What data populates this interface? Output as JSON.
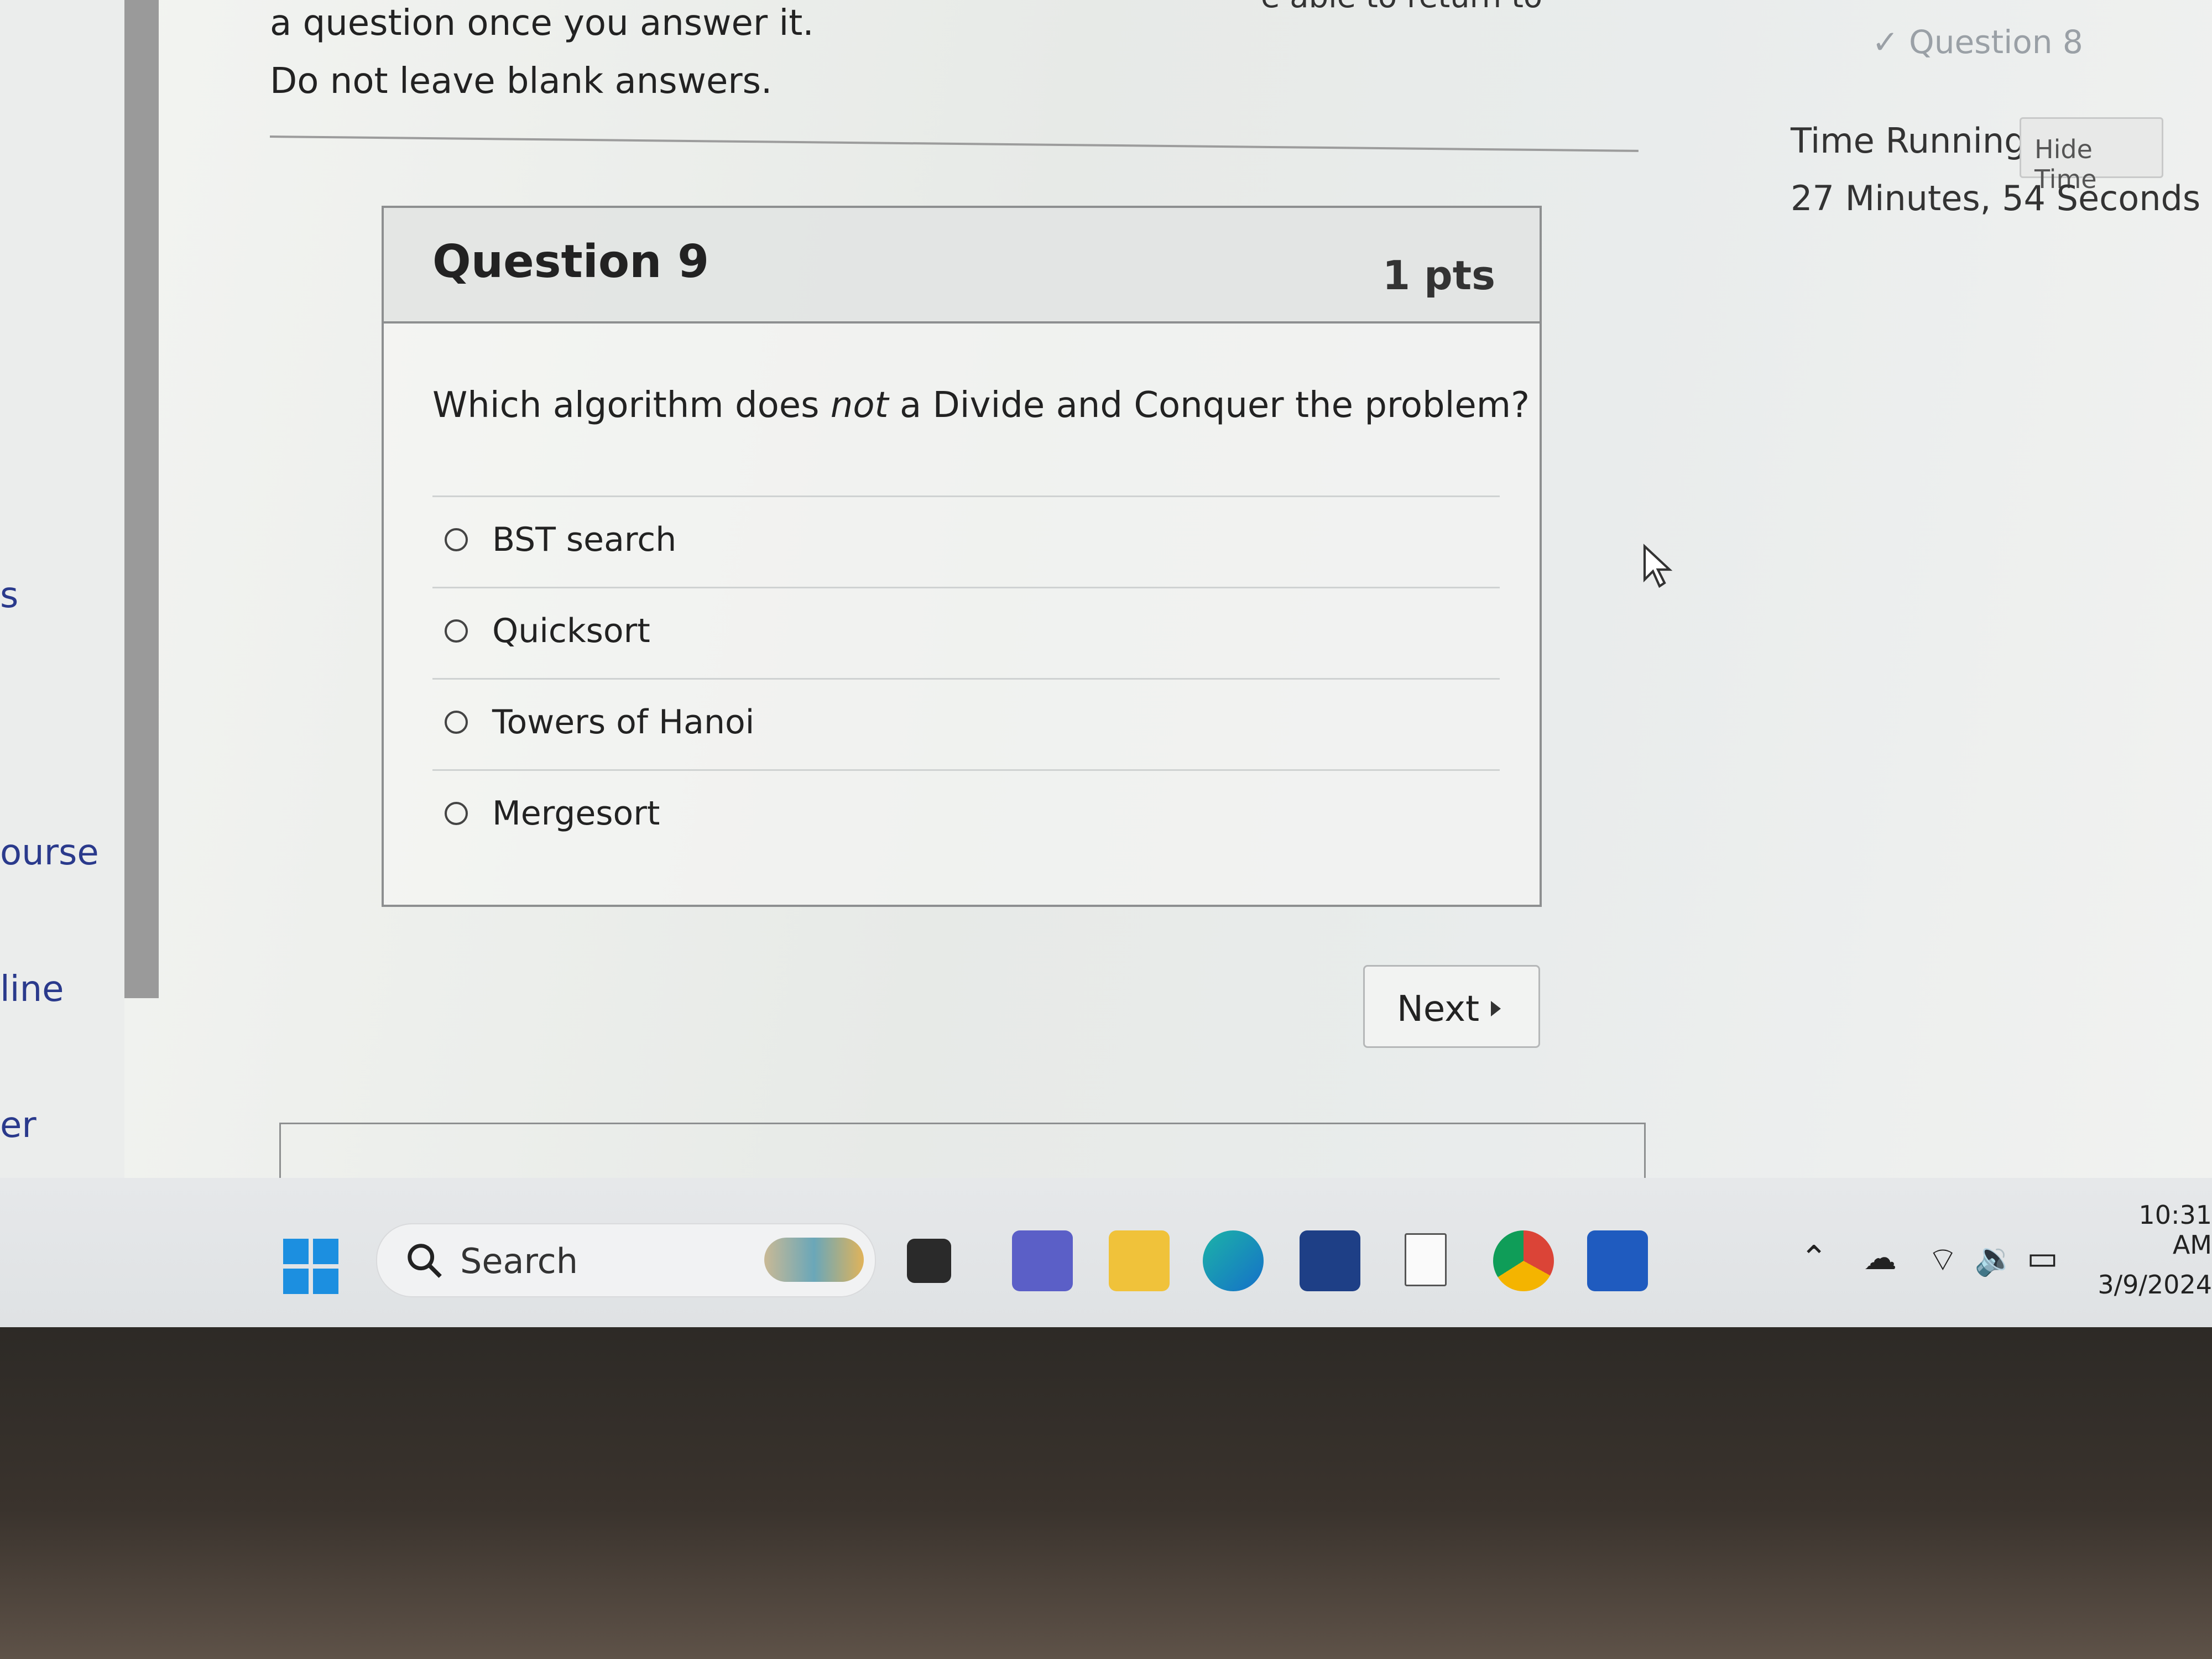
{
  "left_nav": {
    "items": [
      "s",
      "ourse",
      "line",
      "er"
    ]
  },
  "instructions": {
    "top_cut": "e able to return to",
    "line1": "a question once you answer it.",
    "line2": "Do not leave blank answers."
  },
  "question": {
    "title": "Question 9",
    "points": "1 pts",
    "text": "Which algorithm does not a Divide and Conquer the problem?",
    "answers": [
      "BST search",
      "Quicksort",
      "Towers of Hanoi",
      "Mergesort"
    ]
  },
  "nav": {
    "next_label": "Next"
  },
  "sidebar": {
    "previous_question": "Question 8",
    "time_running_label": "Time Running:",
    "hide_time_label": "Hide Time",
    "time_value": "27 Minutes, 54 Seconds"
  },
  "taskbar": {
    "search_label": "Search",
    "clock_time": "10:31 AM",
    "clock_date": "3/9/2024",
    "colors": {
      "accent": "#1c8fe0",
      "word": "#1f5bbf",
      "chrome_red": "#db4437"
    }
  }
}
